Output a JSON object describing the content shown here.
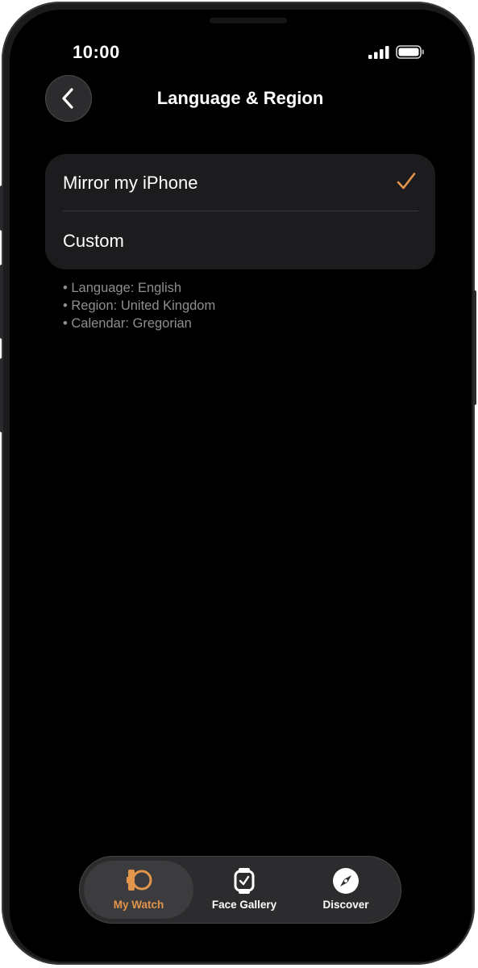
{
  "status_bar": {
    "time": "10:00",
    "signal_icon": "cellular-signal-icon",
    "battery_icon": "battery-icon"
  },
  "nav": {
    "back_icon": "chevron-left-icon",
    "title": "Language & Region"
  },
  "options": [
    {
      "label": "Mirror my iPhone",
      "selected": true
    },
    {
      "label": "Custom",
      "selected": false
    }
  ],
  "info_lines": [
    "• Language: English",
    "• Region: United Kingdom",
    "• Calendar: Gregorian"
  ],
  "tabbar": {
    "tabs": [
      {
        "label": "My Watch",
        "icon": "watch-side-icon",
        "active": true
      },
      {
        "label": "Face Gallery",
        "icon": "watch-face-icon",
        "active": false
      },
      {
        "label": "Discover",
        "icon": "compass-icon",
        "active": false
      }
    ]
  },
  "colors": {
    "accent": "#E3954C",
    "background": "#000000",
    "card": "#1C1C1E",
    "secondary_text": "#8E8E93"
  }
}
